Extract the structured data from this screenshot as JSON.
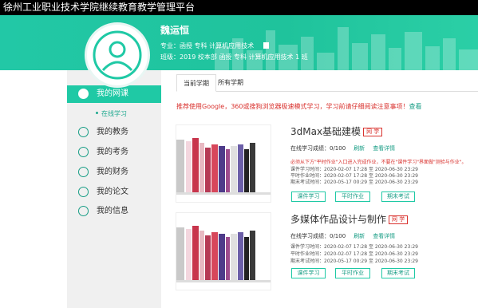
{
  "header": {
    "title": "徐州工业职业技术学院继续教育教学管理平台"
  },
  "user": {
    "name": "魏运恒",
    "major_line": "专业：函授 专科 计算机应用技术",
    "class_line": "班级：2019 校本部 函授 专科 计算机应用技术 1 班"
  },
  "sidebar": {
    "items": [
      {
        "label": "我的网课",
        "icon": "course-icon"
      },
      {
        "label": "我的教务",
        "icon": "calendar-icon"
      },
      {
        "label": "我的考务",
        "icon": "exam-icon"
      },
      {
        "label": "我的财务",
        "icon": "finance-icon"
      },
      {
        "label": "我的论文",
        "icon": "paper-icon"
      },
      {
        "label": "我的信息",
        "icon": "user-icon"
      }
    ],
    "sub_item": "在线学习"
  },
  "tabs": [
    "当前学期",
    "所有学期"
  ],
  "notice": {
    "text": "推荐使用Google，360或搜狗浏览器极速模式学习，学习前请仔细阅读注意事项！",
    "link": "查看"
  },
  "courses": [
    {
      "title": "3dMax基础建模",
      "tag": "网 学",
      "score": "在线学习成绩：0/100",
      "refresh": "刷新",
      "detail": "查看详情",
      "note": "必须从下方\"平时作业\"入口进入完成作业，不要在\"课件学习\"界面做\"测验与作业\"。",
      "times": [
        "课件学习时间：2020-02-07 17:28 至 2020-06-30 23:29",
        "平时作业时间：2020-02-07 17:28 至 2020-06-30 23:29",
        "期末考试时间：2020-05-17 00:29 至 2020-06-30 23:29"
      ],
      "buttons": [
        "课件学习",
        "平时作业",
        "期末考试"
      ]
    },
    {
      "title": "多媒体作品设计与制作",
      "tag": "网 学",
      "score": "在线学习成绩：0/100",
      "refresh": "刷新",
      "detail": "查看详情",
      "times": [
        "课件学习时间：2020-02-07 17:28 至 2020-06-30 23:29",
        "平时作业时间：2020-02-07 17:28 至 2020-06-30 23:29",
        "期末考试时间：2020-05-17 00:29 至 2020-06-30 23:29"
      ],
      "buttons": [
        "课件学习",
        "平时作业",
        "期末考试"
      ]
    }
  ],
  "colors": {
    "accent": "#1fc9a5",
    "warning": "#d9322e"
  }
}
